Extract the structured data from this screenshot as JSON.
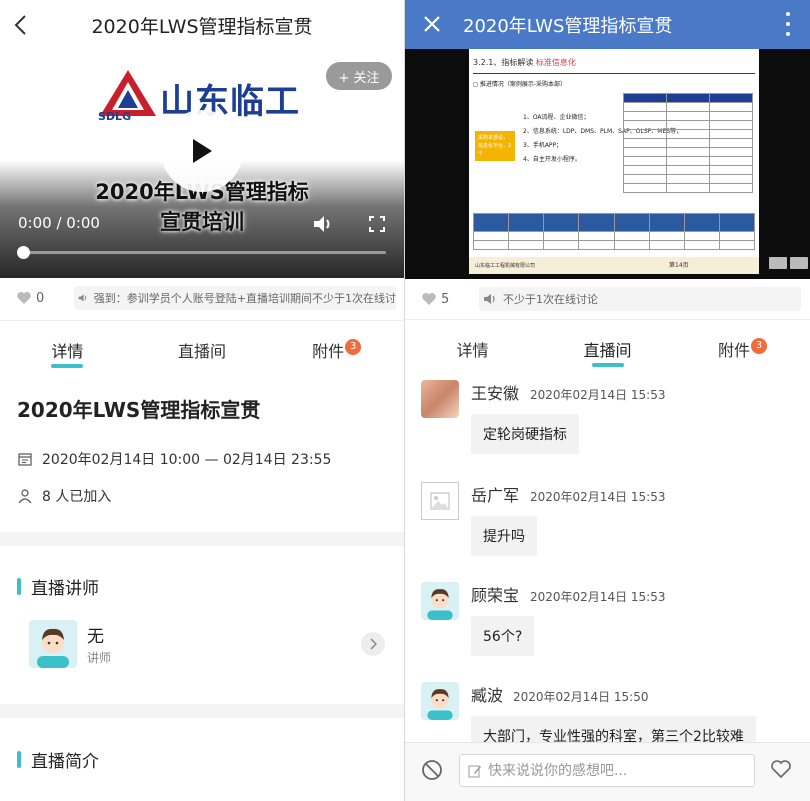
{
  "left": {
    "header": {
      "title": "2020年LWS管理指标宣贯"
    },
    "video": {
      "logo_text": "山东临工",
      "logo_sub": "SDLG",
      "title_line1": "2020年LWS管理指标",
      "title_line2": "宣贯培训",
      "time": "0:00 / 0:00",
      "follow_label": "+ 关注",
      "progress": 0
    },
    "like_count": "0",
    "notice": "强到：参训学员个人账号登陆+直播培训期间不少于1次在线讨",
    "tabs": [
      {
        "label": "详情",
        "active": true
      },
      {
        "label": "直播间",
        "active": false
      },
      {
        "label": "附件",
        "active": false,
        "badge": "3"
      }
    ],
    "detail": {
      "title": "2020年LWS管理指标宣贯",
      "time_range": "2020年02月14日 10:00 — 02月14日 23:55",
      "joined": "8 人已加入"
    },
    "lecturer_section": {
      "title": "直播讲师",
      "name": "无",
      "role": "讲师"
    },
    "intro_section": {
      "title": "直播简介"
    }
  },
  "right": {
    "header": {
      "title": "2020年LWS管理指标宣贯"
    },
    "slide": {
      "heading_prefix": "3.2.1、指标解读",
      "heading_emph": "标准信息化",
      "subheading": "◻ 推进情况（案例展示-采购本部）",
      "yellow_box": "采购本部设，信息化平台，2个",
      "points": [
        "1、OA流程、企业微信；",
        "2、信息系统：LDP、DMS、PLM、SAP、OLSP、MES等；",
        "3、手机APP；",
        "4、自主开发小程序。"
      ],
      "footer": "山东临工工程机械有限公司",
      "page": "第14页"
    },
    "like_count": "5",
    "notice": "不少于1次在线讨论",
    "tabs": [
      {
        "label": "详情",
        "active": false
      },
      {
        "label": "直播间",
        "active": true
      },
      {
        "label": "附件",
        "active": false,
        "badge": "3"
      }
    ],
    "messages": [
      {
        "name": "王安徽",
        "time": "2020年02月14日 15:53",
        "text": "定轮岗硬指标",
        "avatar": "photo"
      },
      {
        "name": "岳广军",
        "time": "2020年02月14日 15:53",
        "text": "提升吗",
        "avatar": "placeholder"
      },
      {
        "name": "顾荣宝",
        "time": "2020年02月14日 15:53",
        "text": "56个?",
        "avatar": "cartoon"
      },
      {
        "name": "臧波",
        "time": "2020年02月14日 15:50",
        "text": "大部门，专业性强的科室，第三个2比较难",
        "avatar": "cartoon"
      }
    ],
    "input": {
      "placeholder": "快来说说你的感想吧..."
    }
  },
  "colors": {
    "accent": "#3bbfc8",
    "header_blue": "#4a7ac7",
    "badge": "#f26b3a",
    "brand_blue": "#1c3f94"
  }
}
